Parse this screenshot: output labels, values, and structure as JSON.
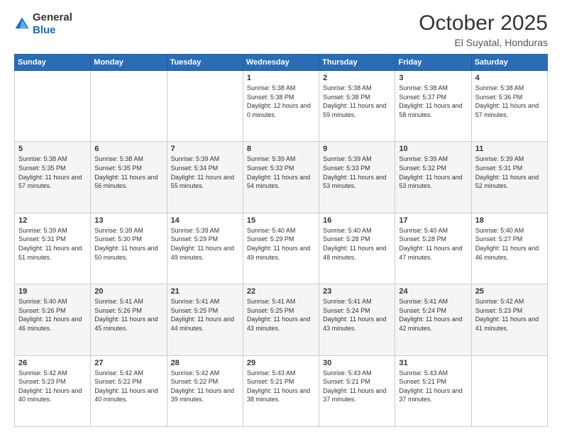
{
  "header": {
    "logo_general": "General",
    "logo_blue": "Blue",
    "month": "October 2025",
    "location": "El Suyatal, Honduras"
  },
  "days_of_week": [
    "Sunday",
    "Monday",
    "Tuesday",
    "Wednesday",
    "Thursday",
    "Friday",
    "Saturday"
  ],
  "weeks": [
    [
      {
        "day": "",
        "info": ""
      },
      {
        "day": "",
        "info": ""
      },
      {
        "day": "",
        "info": ""
      },
      {
        "day": "1",
        "info": "Sunrise: 5:38 AM\nSunset: 5:38 PM\nDaylight: 12 hours\nand 0 minutes."
      },
      {
        "day": "2",
        "info": "Sunrise: 5:38 AM\nSunset: 5:38 PM\nDaylight: 11 hours\nand 59 minutes."
      },
      {
        "day": "3",
        "info": "Sunrise: 5:38 AM\nSunset: 5:37 PM\nDaylight: 11 hours\nand 58 minutes."
      },
      {
        "day": "4",
        "info": "Sunrise: 5:38 AM\nSunset: 5:36 PM\nDaylight: 11 hours\nand 57 minutes."
      }
    ],
    [
      {
        "day": "5",
        "info": "Sunrise: 5:38 AM\nSunset: 5:35 PM\nDaylight: 11 hours\nand 57 minutes."
      },
      {
        "day": "6",
        "info": "Sunrise: 5:38 AM\nSunset: 5:35 PM\nDaylight: 11 hours\nand 56 minutes."
      },
      {
        "day": "7",
        "info": "Sunrise: 5:39 AM\nSunset: 5:34 PM\nDaylight: 11 hours\nand 55 minutes."
      },
      {
        "day": "8",
        "info": "Sunrise: 5:39 AM\nSunset: 5:33 PM\nDaylight: 11 hours\nand 54 minutes."
      },
      {
        "day": "9",
        "info": "Sunrise: 5:39 AM\nSunset: 5:33 PM\nDaylight: 11 hours\nand 53 minutes."
      },
      {
        "day": "10",
        "info": "Sunrise: 5:39 AM\nSunset: 5:32 PM\nDaylight: 11 hours\nand 53 minutes."
      },
      {
        "day": "11",
        "info": "Sunrise: 5:39 AM\nSunset: 5:31 PM\nDaylight: 11 hours\nand 52 minutes."
      }
    ],
    [
      {
        "day": "12",
        "info": "Sunrise: 5:39 AM\nSunset: 5:31 PM\nDaylight: 11 hours\nand 51 minutes."
      },
      {
        "day": "13",
        "info": "Sunrise: 5:39 AM\nSunset: 5:30 PM\nDaylight: 11 hours\nand 50 minutes."
      },
      {
        "day": "14",
        "info": "Sunrise: 5:39 AM\nSunset: 5:29 PM\nDaylight: 11 hours\nand 49 minutes."
      },
      {
        "day": "15",
        "info": "Sunrise: 5:40 AM\nSunset: 5:29 PM\nDaylight: 11 hours\nand 49 minutes."
      },
      {
        "day": "16",
        "info": "Sunrise: 5:40 AM\nSunset: 5:28 PM\nDaylight: 11 hours\nand 48 minutes."
      },
      {
        "day": "17",
        "info": "Sunrise: 5:40 AM\nSunset: 5:28 PM\nDaylight: 11 hours\nand 47 minutes."
      },
      {
        "day": "18",
        "info": "Sunrise: 5:40 AM\nSunset: 5:27 PM\nDaylight: 11 hours\nand 46 minutes."
      }
    ],
    [
      {
        "day": "19",
        "info": "Sunrise: 5:40 AM\nSunset: 5:26 PM\nDaylight: 11 hours\nand 46 minutes."
      },
      {
        "day": "20",
        "info": "Sunrise: 5:41 AM\nSunset: 5:26 PM\nDaylight: 11 hours\nand 45 minutes."
      },
      {
        "day": "21",
        "info": "Sunrise: 5:41 AM\nSunset: 5:25 PM\nDaylight: 11 hours\nand 44 minutes."
      },
      {
        "day": "22",
        "info": "Sunrise: 5:41 AM\nSunset: 5:25 PM\nDaylight: 11 hours\nand 43 minutes."
      },
      {
        "day": "23",
        "info": "Sunrise: 5:41 AM\nSunset: 5:24 PM\nDaylight: 11 hours\nand 43 minutes."
      },
      {
        "day": "24",
        "info": "Sunrise: 5:41 AM\nSunset: 5:24 PM\nDaylight: 11 hours\nand 42 minutes."
      },
      {
        "day": "25",
        "info": "Sunrise: 5:42 AM\nSunset: 5:23 PM\nDaylight: 11 hours\nand 41 minutes."
      }
    ],
    [
      {
        "day": "26",
        "info": "Sunrise: 5:42 AM\nSunset: 5:23 PM\nDaylight: 11 hours\nand 40 minutes."
      },
      {
        "day": "27",
        "info": "Sunrise: 5:42 AM\nSunset: 5:22 PM\nDaylight: 11 hours\nand 40 minutes."
      },
      {
        "day": "28",
        "info": "Sunrise: 5:42 AM\nSunset: 5:22 PM\nDaylight: 11 hours\nand 39 minutes."
      },
      {
        "day": "29",
        "info": "Sunrise: 5:43 AM\nSunset: 5:21 PM\nDaylight: 11 hours\nand 38 minutes."
      },
      {
        "day": "30",
        "info": "Sunrise: 5:43 AM\nSunset: 5:21 PM\nDaylight: 11 hours\nand 37 minutes."
      },
      {
        "day": "31",
        "info": "Sunrise: 5:43 AM\nSunset: 5:21 PM\nDaylight: 11 hours\nand 37 minutes."
      },
      {
        "day": "",
        "info": ""
      }
    ]
  ]
}
